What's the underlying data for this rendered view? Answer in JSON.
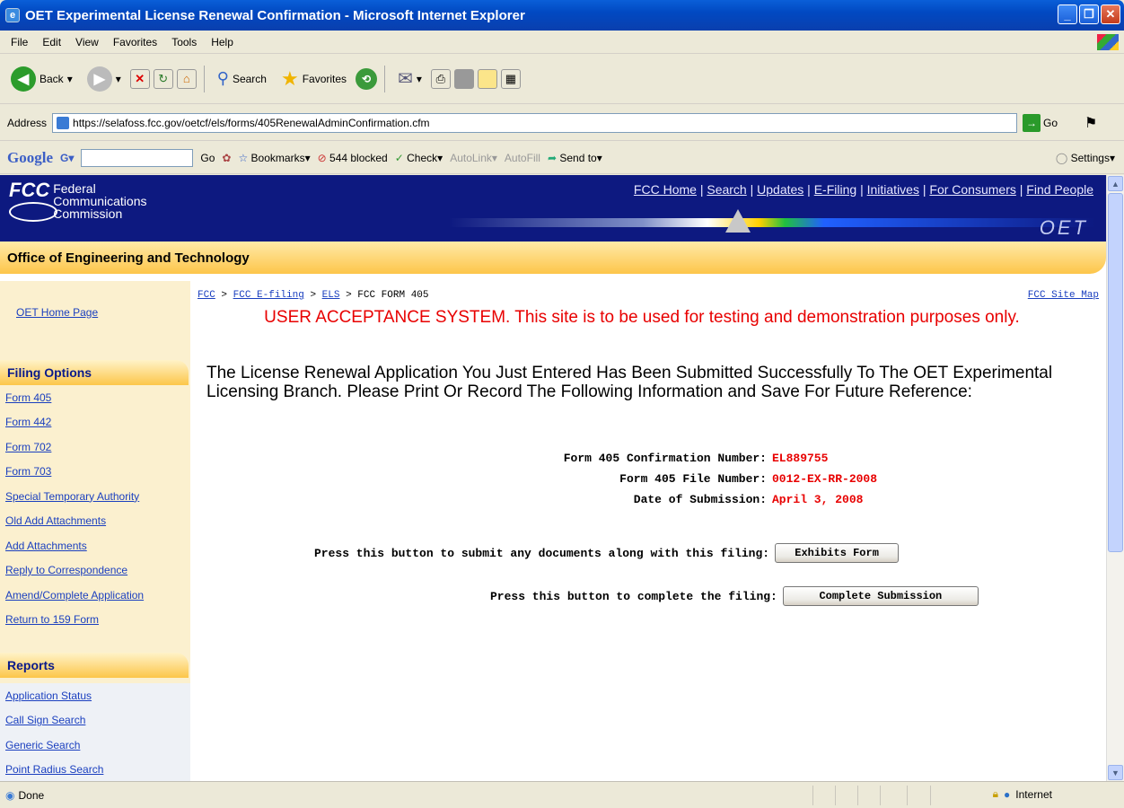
{
  "window": {
    "title": "OET Experimental License Renewal Confirmation - Microsoft Internet Explorer",
    "controls": {
      "minimize": "_",
      "maximize": "❐",
      "close": "✕"
    }
  },
  "menu": [
    "File",
    "Edit",
    "View",
    "Favorites",
    "Tools",
    "Help"
  ],
  "toolbar": {
    "back": "Back",
    "search": "Search",
    "favorites": "Favorites"
  },
  "address": {
    "label": "Address",
    "url": "https://selafoss.fcc.gov/oetcf/els/forms/405RenewalAdminConfirmation.cfm",
    "go": "Go"
  },
  "google_bar": {
    "logo": "Google",
    "go": "Go",
    "bookmarks": "Bookmarks",
    "blocked": "544 blocked",
    "check": "Check",
    "autolink": "AutoLink",
    "autofill": "AutoFill",
    "sendto": "Send to",
    "settings": "Settings"
  },
  "header": {
    "logo_mark": "FCC",
    "logo_lines": [
      "Federal",
      "Communications",
      "Commission"
    ],
    "links": [
      "FCC Home",
      "Search",
      "Updates",
      "E-Filing",
      "Initiatives",
      "For Consumers",
      "Find People"
    ],
    "oet_logo": "OET",
    "office": "Office of Engineering and Technology"
  },
  "sidebar": {
    "home": "OET Home Page",
    "filing_title": "Filing Options",
    "filing_items": [
      "Form 405",
      "Form 442",
      "Form 702",
      "Form 703",
      "Special Temporary Authority",
      "Old Add Attachments",
      "Add Attachments",
      "Reply to Correspondence",
      "Amend/Complete Application",
      "Return to 159 Form"
    ],
    "reports_title": "Reports",
    "report_items": [
      "Application Status",
      "Call Sign Search",
      "Generic Search",
      "Point Radius Search"
    ]
  },
  "breadcrumb": {
    "items": [
      "FCC",
      "FCC E-filing",
      "ELS"
    ],
    "current": "FCC FORM 405",
    "sitemap": "FCC Site Map"
  },
  "notice": "USER ACCEPTANCE SYSTEM. This site is to be used for testing and demonstration purposes only.",
  "message": "The License Renewal Application You Just Entered Has Been Submitted Successfully To The OET Experimental Licensing Branch. Please Print Or Record The Following Information and Save For Future Reference:",
  "info": [
    {
      "label": "Form 405 Confirmation Number:",
      "value": "EL889755"
    },
    {
      "label": "Form 405 File Number:",
      "value": "0012-EX-RR-2008"
    },
    {
      "label": "Date of Submission:",
      "value": "April 3, 2008"
    }
  ],
  "actions": {
    "exhibits_prompt": "Press this button to submit any documents along with this filing:",
    "exhibits_button": "Exhibits Form",
    "complete_prompt": "Press this button to complete the filing:",
    "complete_button": "Complete Submission"
  },
  "status": {
    "text": "Done",
    "zone": "Internet"
  }
}
